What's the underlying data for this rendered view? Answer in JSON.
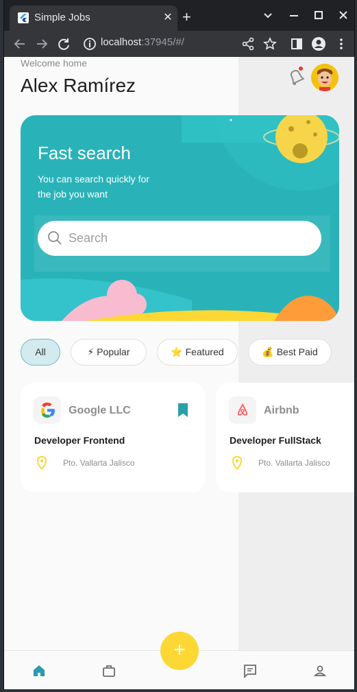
{
  "browser": {
    "tab_title": "Simple Jobs",
    "tab_close": "✕",
    "new_tab": "+",
    "url_host": "localhost",
    "url_path": ":37945/#/",
    "controls": {
      "dropdown": "⌄",
      "minimize": "–",
      "maximize": "□",
      "close": "✕"
    }
  },
  "header": {
    "welcome": "Welcome home",
    "user_name": "Alex Ramírez"
  },
  "hero": {
    "title": "Fast search",
    "subtitle": "You can search quickly for the job you want",
    "search_placeholder": "Search"
  },
  "chips": [
    {
      "label": "All",
      "active": true
    },
    {
      "label": "⚡ Popular",
      "active": false
    },
    {
      "label": "⭐ Featured",
      "active": false
    },
    {
      "label": "💰 Best Paid",
      "active": false
    }
  ],
  "jobs": [
    {
      "company": "Google LLC",
      "role": "Developer Frontend",
      "location": "Pto. Vallarta Jalisco",
      "bookmarked": true
    },
    {
      "company": "Airbnb",
      "role": "Developer FullStack",
      "location": "Pto. Vallarta Jalisco",
      "bookmarked": false
    }
  ],
  "fab": {
    "label": "+"
  },
  "colors": {
    "accent": "#29b3b8",
    "fab": "#fdd835",
    "nav_active": "#2a9bb0"
  }
}
